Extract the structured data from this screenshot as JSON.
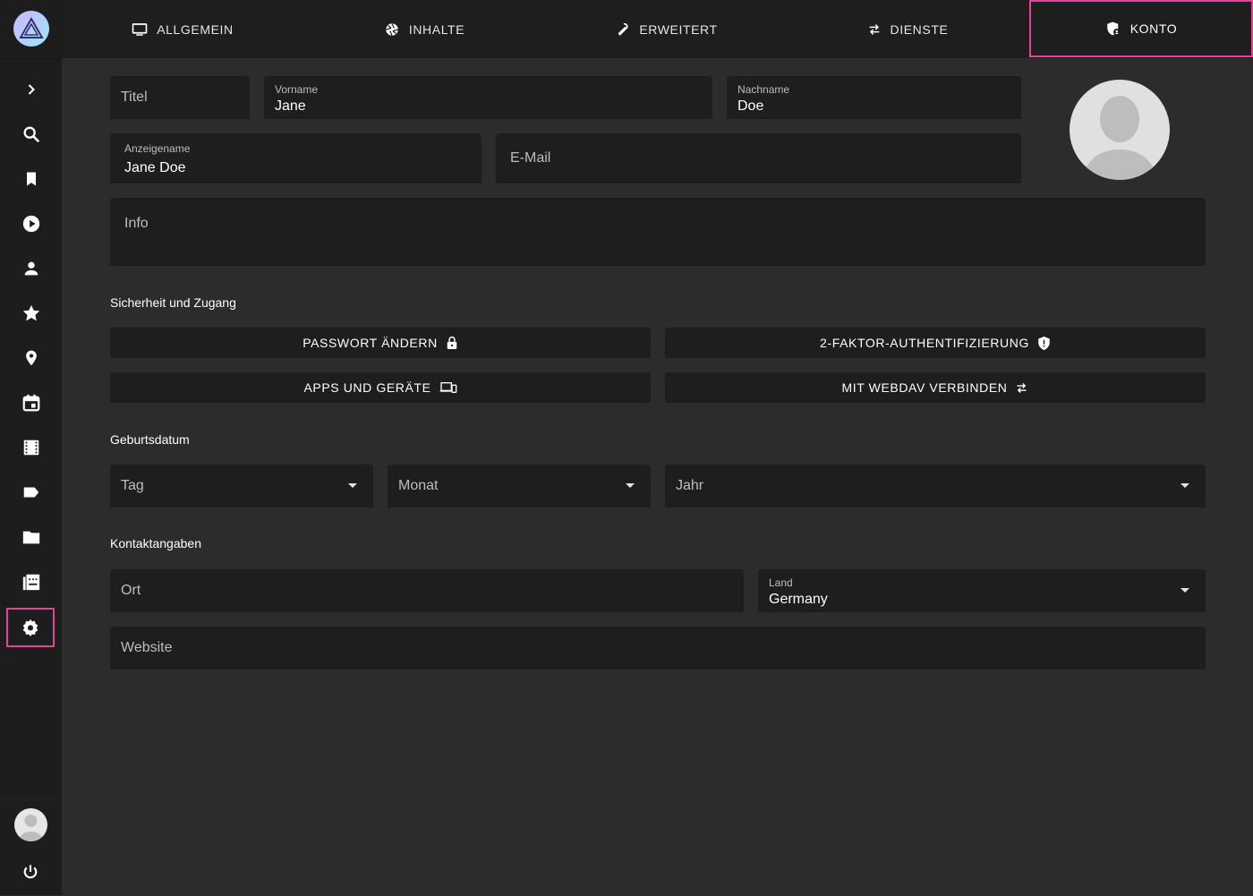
{
  "tabs": [
    {
      "label": "ALLGEMEIN",
      "icon": "monitor-icon"
    },
    {
      "label": "INHALTE",
      "icon": "aperture-icon"
    },
    {
      "label": "ERWEITERT",
      "icon": "wrench-icon"
    },
    {
      "label": "DIENSTE",
      "icon": "swap-icon"
    },
    {
      "label": "KONTO",
      "icon": "account-shield-icon",
      "active": true
    }
  ],
  "sidebar": {
    "items": [
      "expand-icon",
      "search-icon",
      "bookmark-icon",
      "play-icon",
      "person-icon",
      "star-icon",
      "location-icon",
      "calendar-icon",
      "film-icon",
      "label-icon",
      "folder-icon",
      "library-icon",
      "settings-icon"
    ],
    "active": "settings-icon",
    "bottom": [
      "user-avatar",
      "power-icon"
    ]
  },
  "profile": {
    "title_placeholder": "Titel",
    "firstname_label": "Vorname",
    "firstname_value": "Jane",
    "lastname_label": "Nachname",
    "lastname_value": "Doe",
    "displayname_label": "Anzeigename",
    "displayname_value": "Jane Doe",
    "email_placeholder": "E-Mail",
    "info_placeholder": "Info"
  },
  "security": {
    "heading": "Sicherheit und Zugang",
    "change_password": "PASSWORT ÄNDERN",
    "two_factor": "2-FAKTOR-AUTHENTIFIZIERUNG",
    "apps_devices": "APPS UND GERÄTE",
    "webdav": "MIT WEBDAV VERBINDEN"
  },
  "birthday": {
    "heading": "Geburtsdatum",
    "day": "Tag",
    "month": "Monat",
    "year": "Jahr"
  },
  "contact": {
    "heading": "Kontaktangaben",
    "city_placeholder": "Ort",
    "country_label": "Land",
    "country_value": "Germany",
    "website_placeholder": "Website"
  },
  "colors": {
    "background": "#2c2c2c",
    "sidebar": "#1d1d1d",
    "field": "#1e1e1e",
    "highlight": "#e0459a"
  }
}
